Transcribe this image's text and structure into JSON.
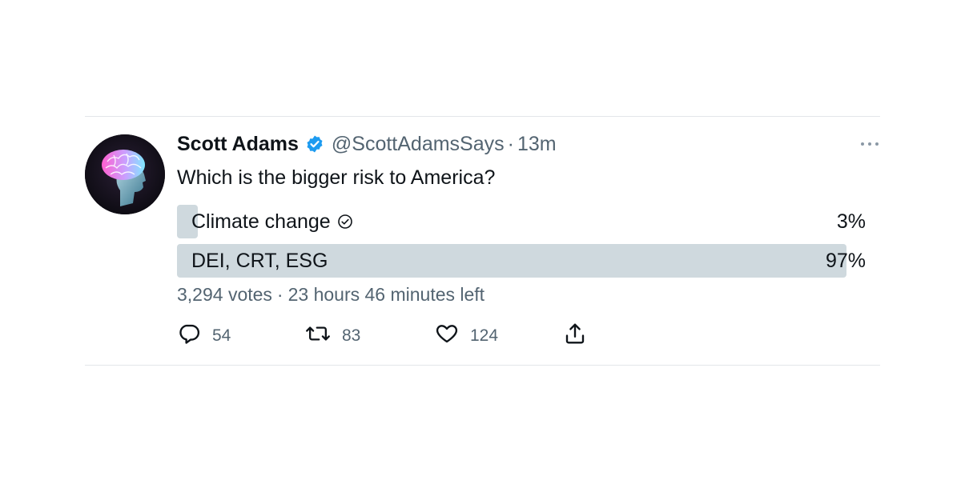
{
  "tweet": {
    "author_name": "Scott Adams",
    "handle": "@ScottAdamsSays",
    "separator": "·",
    "time": "13m",
    "text": "Which is the bigger risk to America?",
    "verified_icon": "verified-badge-icon",
    "more_icon": "more-options-icon"
  },
  "poll": {
    "options": [
      {
        "label": "Climate change",
        "percent_label": "3%",
        "percent": 3,
        "selected": true
      },
      {
        "label": "DEI, CRT, ESG",
        "percent_label": "97%",
        "percent": 97,
        "selected": false
      }
    ],
    "votes": "3,294 votes",
    "dot": "·",
    "time_left": "23 hours 46 minutes left"
  },
  "actions": {
    "reply_count": "54",
    "retweet_count": "83",
    "like_count": "124"
  },
  "colors": {
    "bar": "#cfd9de",
    "text": "#0f1419",
    "secondary": "#536471",
    "verified": "#1d9bf0"
  }
}
